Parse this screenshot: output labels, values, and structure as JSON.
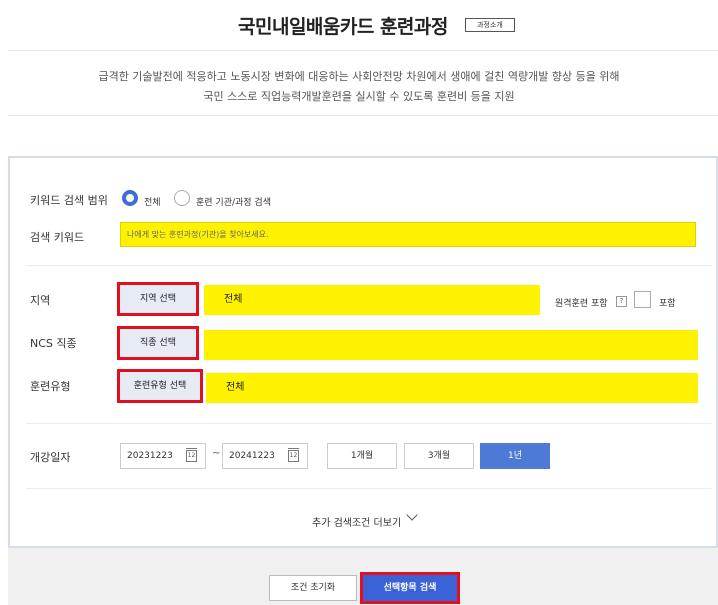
{
  "header": {
    "title": "국민내일배움카드 훈련과정",
    "intro_button": "과정소개"
  },
  "description": {
    "line1": "급격한 기술발전에 적응하고 노동시장 변화에 대응하는 사회안전망 차원에서 생애에 걸친 역량개발 향상 등을 위해",
    "line2": "국민 스스로 직업능력개발훈련을 실시할 수 있도록 훈련비 등을 지원"
  },
  "search": {
    "scope_label": "키워드 검색 범위",
    "scope_options": [
      {
        "label": "전체",
        "selected": true
      },
      {
        "label": "훈련 기관/과정 검색",
        "selected": false
      }
    ],
    "keyword_label": "검색 키워드",
    "keyword_placeholder": "나에게 맞는 훈련과정(기관)을 찾아보세요.",
    "region": {
      "label": "지역",
      "button": "지역 선택",
      "value": "전체"
    },
    "remote": {
      "label": "원격훈련 포함",
      "help": "?",
      "include_label": "포함"
    },
    "ncs": {
      "label": "NCS 직종",
      "button": "직종 선택",
      "value": ""
    },
    "training_type": {
      "label": "훈련유형",
      "button": "훈련유형 선택",
      "value": "전체"
    },
    "date": {
      "label": "개강일자",
      "start": "20231223",
      "end": "20241223",
      "separator": "~",
      "calendar_glyph": "12",
      "periods": [
        {
          "label": "1개월",
          "active": false
        },
        {
          "label": "3개월",
          "active": false
        },
        {
          "label": "1년",
          "active": true
        }
      ]
    },
    "more_conditions": "추가 검색조건 더보기"
  },
  "footer": {
    "reset_button": "조건 초기화",
    "search_button": "선택항목 검색"
  },
  "colors": {
    "accent": "#3e6fd6",
    "highlight": "#fff200",
    "annotation_red": "#e01020",
    "active_period": "#4d7ad4"
  }
}
